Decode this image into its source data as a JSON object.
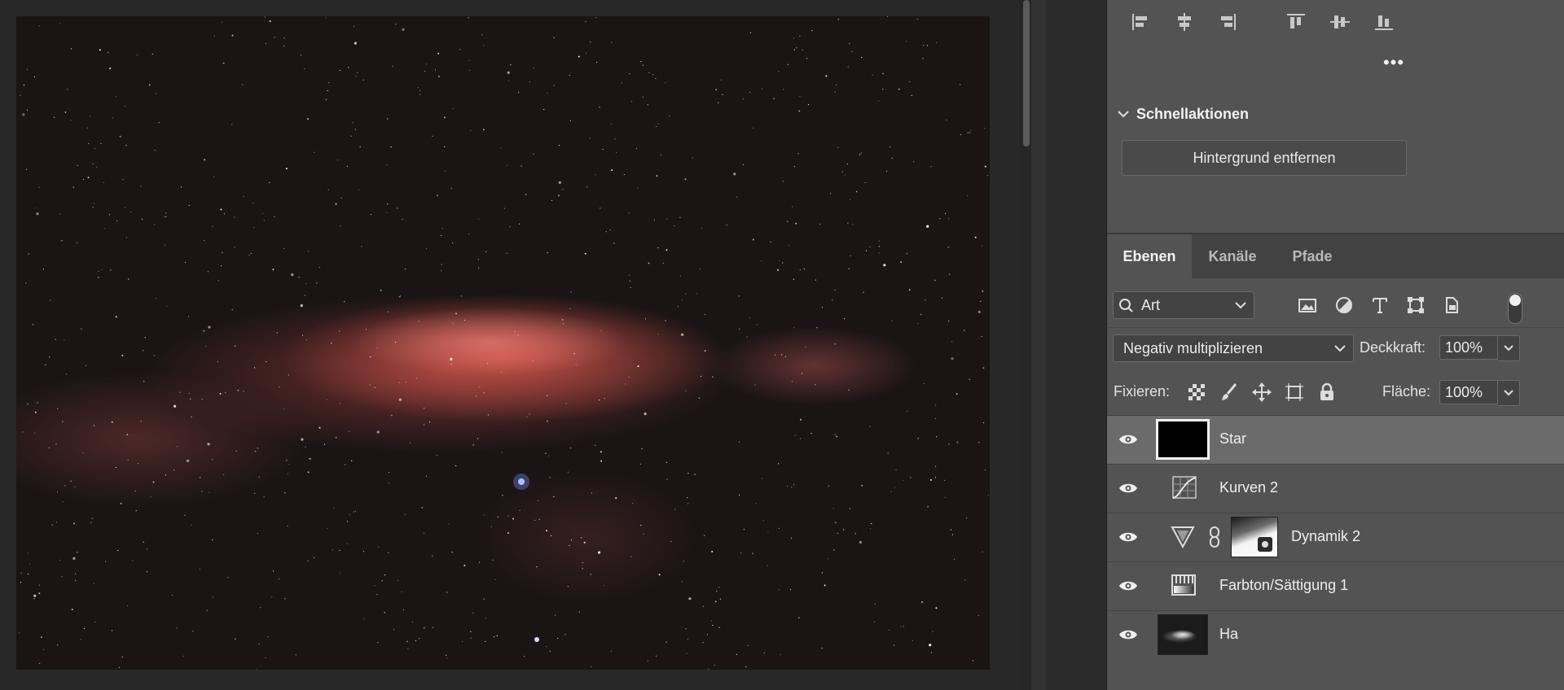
{
  "canvas": {
    "image_subject": "nebula-photo"
  },
  "panel": {
    "more_label": "•••",
    "quick_actions": {
      "title": "Schnellaktionen",
      "remove_bg_button": "Hintergrund entfernen"
    }
  },
  "tabs": [
    {
      "label": "Ebenen",
      "active": true
    },
    {
      "label": "Kanäle",
      "active": false
    },
    {
      "label": "Pfade",
      "active": false
    }
  ],
  "filter": {
    "kind_label": "Art"
  },
  "blend": {
    "mode": "Negativ multiplizieren",
    "opacity_label": "Deckkraft:",
    "opacity_value": "100%",
    "lock_label": "Fixieren:",
    "fill_label": "Fläche:",
    "fill_value": "100%"
  },
  "layers": [
    {
      "name": "Star",
      "selected": true,
      "type": "pixel-dark"
    },
    {
      "name": "Kurven 2",
      "selected": false,
      "type": "curves-adjustment"
    },
    {
      "name": "Dynamik 2",
      "selected": false,
      "type": "vibrance-adjustment-with-mask"
    },
    {
      "name": "Farbton/Sättigung 1",
      "selected": false,
      "type": "hue-saturation-adjustment"
    },
    {
      "name": "Ha",
      "selected": false,
      "type": "pixel-nebula"
    }
  ],
  "colors": {
    "panel_bg": "#535353",
    "selected_layer": "#6b6b6b",
    "canvas_bg": "#282828"
  }
}
